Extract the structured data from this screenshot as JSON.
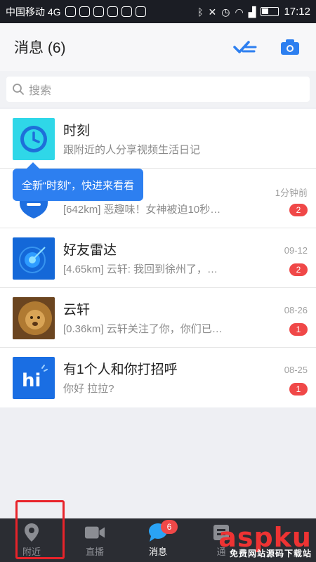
{
  "status_bar": {
    "carrier": "中国移动 4G",
    "time": "17:12"
  },
  "header": {
    "title": "消息 (6)",
    "icons": [
      "read-all-icon",
      "camera-icon"
    ]
  },
  "search": {
    "placeholder": "搜索"
  },
  "tooltip": {
    "text": "全新“时刻”，快进来看看"
  },
  "messages": [
    {
      "name": "时刻",
      "preview": "跟附近的人分享视频生活日记",
      "time": "",
      "badge": "",
      "avatar": "clock-avatar",
      "color": "#2fd7e8"
    },
    {
      "name": "",
      "preview": "[642km] 恶趣味！女神被迫10秒…",
      "time": "1分钟前",
      "badge": "2",
      "avatar": "shield-avatar",
      "color": "#1f6fe0"
    },
    {
      "name": "好友雷达",
      "preview": "[4.65km] 云轩: 我回到徐州了，…",
      "time": "09-12",
      "badge": "2",
      "avatar": "radar-avatar",
      "color": "#1468d8"
    },
    {
      "name": "云轩",
      "preview": "[0.36km] 云轩关注了你，你们已…",
      "time": "08-26",
      "badge": "1",
      "avatar": "lion-avatar",
      "color": "#8a5a22"
    },
    {
      "name": "有1个人和你打招呼",
      "preview": "你好  拉拉?",
      "time": "08-25",
      "badge": "1",
      "avatar": "hi-avatar",
      "color": "#1a6ee3"
    }
  ],
  "tabs": [
    {
      "label": "附近",
      "icon": "location-pin-icon",
      "active": false,
      "badge": ""
    },
    {
      "label": "直播",
      "icon": "video-camera-icon",
      "active": false,
      "badge": ""
    },
    {
      "label": "消息",
      "icon": "chat-bubble-icon",
      "active": true,
      "badge": "6"
    },
    {
      "label": "通",
      "icon": "contacts-icon",
      "active": false,
      "badge": ""
    },
    {
      "label": "",
      "icon": "more-icon",
      "active": false,
      "badge": ""
    }
  ],
  "watermark": {
    "brand": "aspku",
    "sub": "免费网站源码下载站"
  },
  "colors": {
    "accent": "#2d7ff0",
    "badge": "#f04848",
    "tabbar": "#2b2d33"
  }
}
